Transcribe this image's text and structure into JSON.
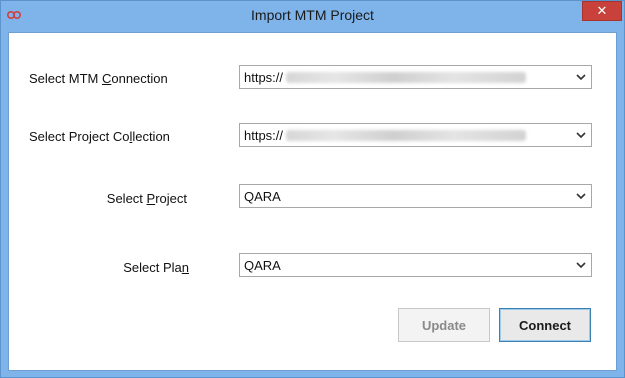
{
  "window": {
    "title": "Import MTM Project",
    "close_glyph": "✕",
    "app_icon": "link-icon"
  },
  "form": {
    "connection": {
      "label_pre": "Select MTM ",
      "label_key": "C",
      "label_post": "onnection",
      "value": "https://"
    },
    "collection": {
      "label_pre": "Select Project Co",
      "label_key": "l",
      "label_post": "lection",
      "value": "https://"
    },
    "project": {
      "label_pre": "Select ",
      "label_key": "P",
      "label_post": "roject",
      "value": "QARA"
    },
    "plan": {
      "label_pre": "Select Pla",
      "label_key": "n",
      "label_post": "",
      "value": "QARA"
    }
  },
  "buttons": {
    "update": "Update",
    "connect": "Connect"
  },
  "colors": {
    "frame": "#7eb4ea",
    "close": "#c8413a",
    "focus_border": "#3c7fb1"
  }
}
